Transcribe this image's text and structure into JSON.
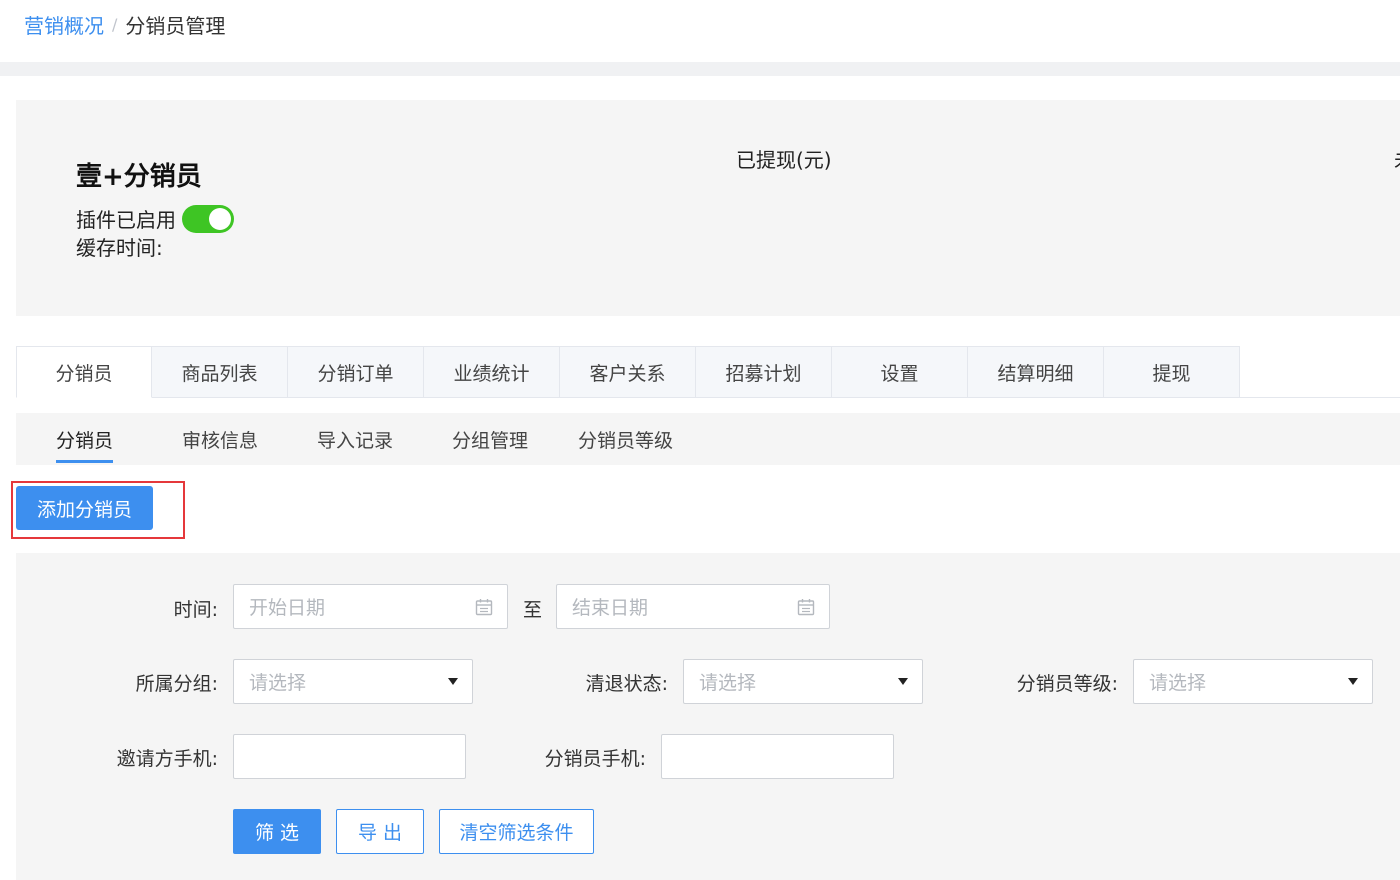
{
  "breadcrumb": {
    "parent": "营销概况",
    "separator": "/",
    "current": "分销员管理"
  },
  "plugin": {
    "title": "壹+分销员",
    "status_label": "插件已启用",
    "enabled": true,
    "cache_time_label": "缓存时间:",
    "withdrawn_label": "已提现(元)",
    "truncated_label": "未"
  },
  "main_tabs": [
    "分销员",
    "商品列表",
    "分销订单",
    "业绩统计",
    "客户关系",
    "招募计划",
    "设置",
    "结算明细",
    "提现"
  ],
  "active_main_tab": "分销员",
  "sub_tabs": [
    "分销员",
    "审核信息",
    "导入记录",
    "分组管理",
    "分销员等级"
  ],
  "active_sub_tab": "分销员",
  "add_button_label": "添加分销员",
  "filters": {
    "time_label": "时间:",
    "start_placeholder": "开始日期",
    "range_separator": "至",
    "end_placeholder": "结束日期",
    "group_label": "所属分组:",
    "group_value": "请选择",
    "status_label": "清退状态:",
    "status_value": "请选择",
    "level_label": "分销员等级:",
    "level_value": "请选择",
    "inviter_phone_label": "邀请方手机:",
    "inviter_phone_value": "",
    "distributor_phone_label": "分销员手机:",
    "distributor_phone_value": ""
  },
  "actions": {
    "filter": "筛 选",
    "export": "导 出",
    "clear": "清空筛选条件"
  },
  "colors": {
    "accent": "#3d8fef",
    "toggle_on": "#3ec524",
    "highlight_border": "#e5383b"
  }
}
